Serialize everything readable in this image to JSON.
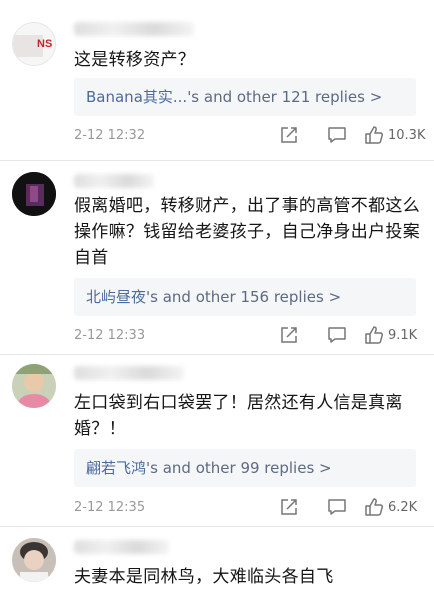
{
  "icons": {
    "share": "share-icon",
    "comment": "comment-icon",
    "like": "thumbs-up-icon"
  },
  "colors": {
    "reply_link": "#4c6a9e",
    "reply_bg": "#f5f6f8",
    "meta_text": "#999999"
  },
  "comments": [
    {
      "avatar_text": "NS",
      "text": "这是转移资产？",
      "reply_name": "Banana其实...",
      "reply_suffix": "'s and other 121 replies >",
      "time": "2-12 12:32",
      "likes": "10.3K"
    },
    {
      "text": "假离婚吧，转移财产，出了事的高管不都这么操作嘛？钱留给老婆孩子，自己净身出户投案自首",
      "reply_name": "北屿昼夜",
      "reply_suffix": "'s and other 156 replies >",
      "time": "2-12 12:33",
      "likes": "9.1K"
    },
    {
      "text": "左口袋到右口袋罢了！居然还有人信是真离婚？！",
      "reply_name": "翩若飞鸿",
      "reply_suffix": "'s and other 99 replies >",
      "time": "2-12 12:35",
      "likes": "6.2K"
    },
    {
      "text": "夫妻本是同林鸟，大难临头各自飞"
    }
  ]
}
